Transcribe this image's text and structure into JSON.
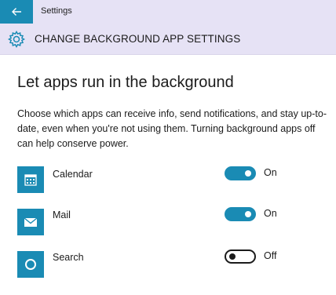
{
  "titlebar": {
    "title": "Settings",
    "back_icon": "back-arrow-icon"
  },
  "header": {
    "icon": "gear-icon",
    "title": "CHANGE BACKGROUND APP SETTINGS"
  },
  "main": {
    "heading": "Let apps run in the background",
    "description": "Choose which apps can receive info, send notifications, and stay up-to-date, even when you're not using them. Turning background apps off can help conserve power.",
    "apps": [
      {
        "name": "Calendar",
        "icon": "calendar-icon",
        "enabled": true,
        "state_label": "On"
      },
      {
        "name": "Mail",
        "icon": "mail-icon",
        "enabled": true,
        "state_label": "On"
      },
      {
        "name": "Search",
        "icon": "search-icon",
        "enabled": false,
        "state_label": "Off"
      }
    ]
  },
  "colors": {
    "accent": "#1a8bb4",
    "header_bg": "#e6e2f5",
    "text": "#1b1b1b"
  }
}
